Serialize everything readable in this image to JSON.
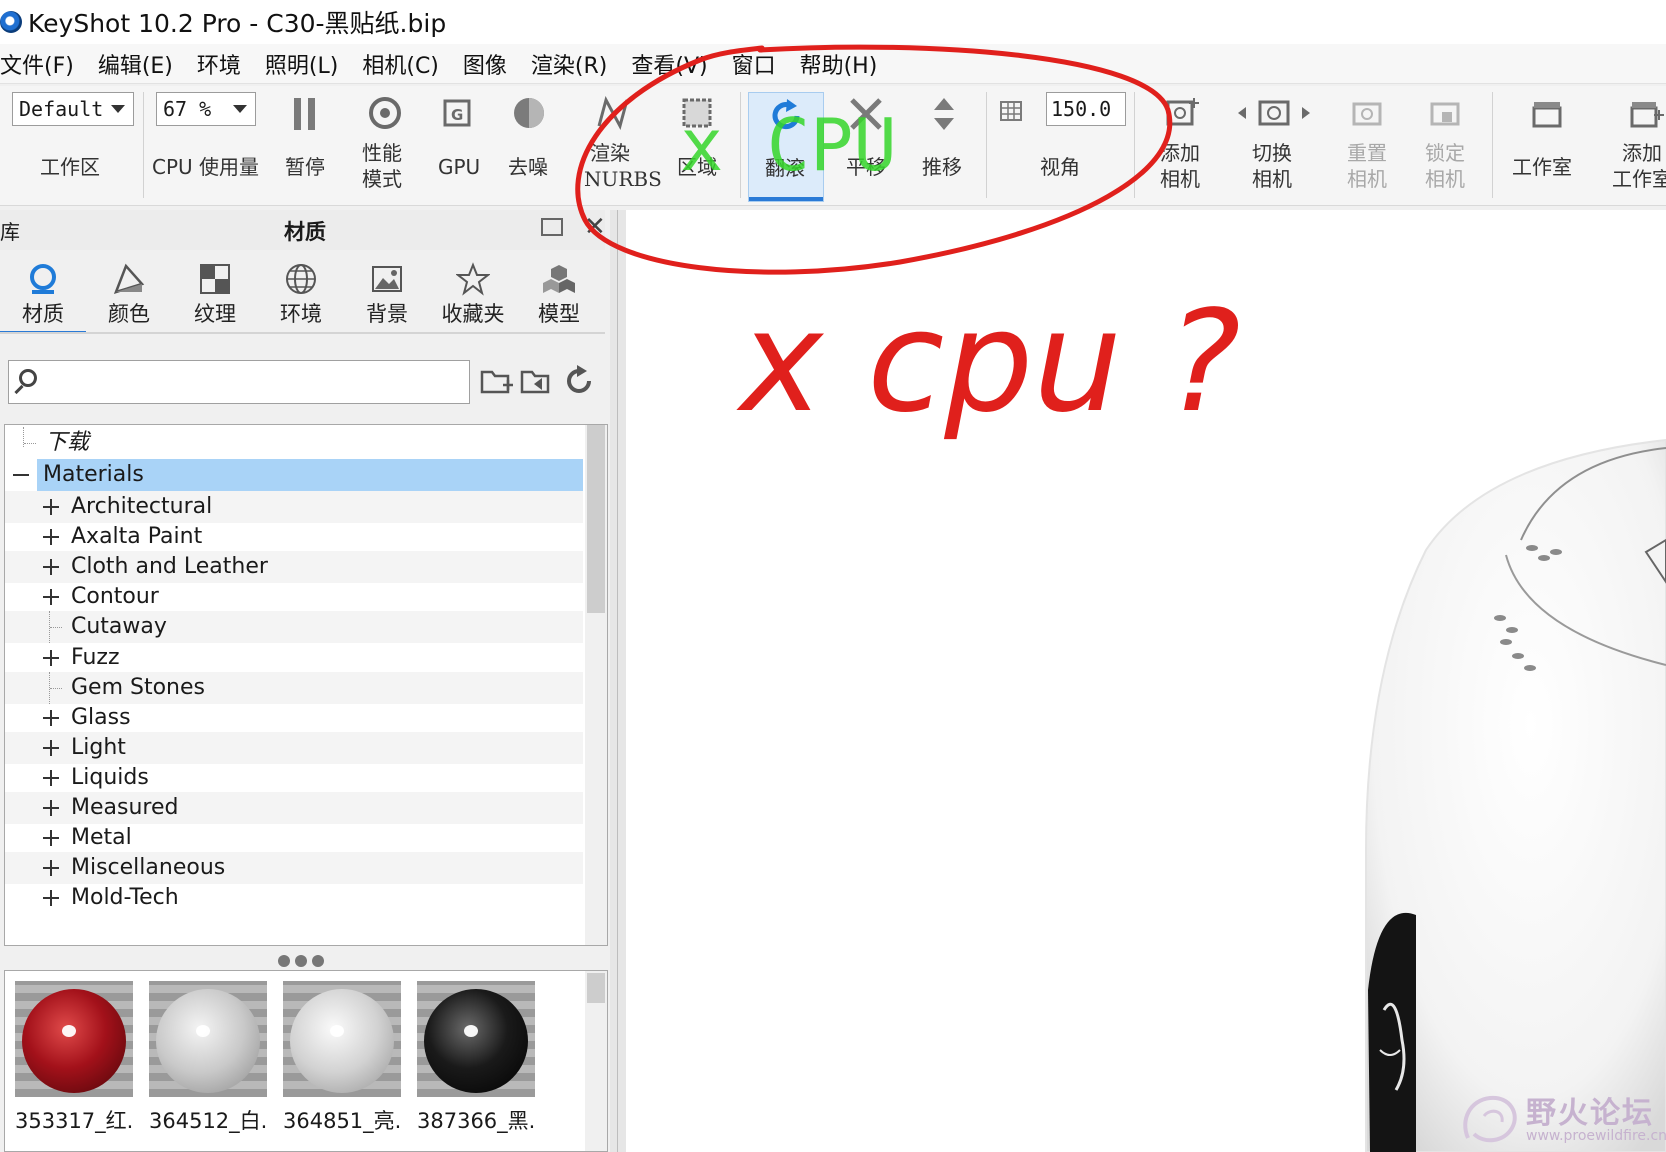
{
  "window": {
    "title": "KeyShot 10.2 Pro  - C30-黑贴纸.bip"
  },
  "menu": [
    "文件(F)",
    "编辑(E)",
    "环境",
    "照明(L)",
    "相机(C)",
    "图像",
    "渲染(R)",
    "查看(V)",
    "窗口",
    "帮助(H)"
  ],
  "toolbar": {
    "workspace_value": "Default",
    "workspace_label": "工作区",
    "cpu_value": "67 %",
    "cpu_label": "CPU 使用量",
    "pause": "暂停",
    "perf_mode_1": "性能",
    "perf_mode_2": "模式",
    "gpu": "GPU",
    "denoise": "去噪",
    "nurbs_1": "渲染",
    "nurbs_2": "NURBS",
    "region": "区域",
    "tumble": "翻滚",
    "pan": "平移",
    "dolly": "推移",
    "fov_value": "150.0",
    "fov_label": "视角",
    "add_cam_1": "添加",
    "add_cam_2": "相机",
    "switch_cam_1": "切换",
    "switch_cam_2": "相机",
    "reset_cam_1": "重置",
    "reset_cam_2": "相机",
    "lock_cam_1": "锁定",
    "lock_cam_2": "相机",
    "studio": "工作室",
    "add_studio_1": "添加",
    "add_studio_2": "工作室"
  },
  "panel": {
    "library_label": "库",
    "title": "材质",
    "tabs": [
      "材质",
      "颜色",
      "纹理",
      "环境",
      "背景",
      "收藏夹",
      "模型"
    ],
    "search_placeholder": "",
    "tree": {
      "download": "下载",
      "root": "Materials",
      "items": [
        "Architectural",
        "Axalta Paint",
        "Cloth and Leather",
        "Contour",
        "Cutaway",
        "Fuzz",
        "Gem Stones",
        "Glass",
        "Light",
        "Liquids",
        "Measured",
        "Metal",
        "Miscellaneous",
        "Mold-Tech"
      ]
    },
    "thumbnails": [
      "353317_红...",
      "364512_白...",
      "364851_亮...",
      "387366_黑..."
    ]
  },
  "annotations": {
    "green_text": "x CPU",
    "handwritten": "x cpu ?"
  },
  "watermark": {
    "name": "野火论坛",
    "url": "www.proewildfire.cn"
  },
  "colors": {
    "annotation_red": "#e0201c",
    "annotation_green": "#35d62a",
    "accent": "#2a7ad6",
    "selection": "#a9d3f7"
  }
}
